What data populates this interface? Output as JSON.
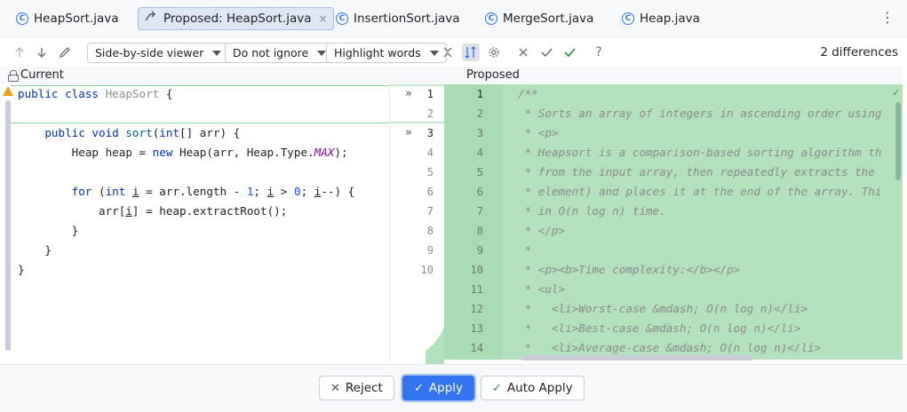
{
  "tabs": [
    {
      "label": "HeapSort.java",
      "icon": "class-icon",
      "active": false
    },
    {
      "label": "Proposed: HeapSort.java",
      "icon": "merge-icon",
      "active": true
    },
    {
      "label": "InsertionSort.java",
      "icon": "class-icon",
      "active": false
    },
    {
      "label": "MergeSort.java",
      "icon": "class-icon",
      "active": false
    },
    {
      "label": "Heap.java",
      "icon": "class-icon",
      "active": false
    }
  ],
  "class_icon_letter": "C",
  "tab_close": "×",
  "more_glyph": "⋮",
  "toolbar": {
    "viewer": "Side-by-side viewer",
    "ignore": "Do not ignore",
    "highlight": "Highlight words",
    "differences": "2 differences",
    "help": "?"
  },
  "panes": {
    "current": "Current",
    "proposed": "Proposed"
  },
  "left_code": [
    "public class HeapSort {",
    "",
    "    public void sort(int[] arr) {",
    "        Heap heap = new Heap(arr, Heap.Type.MAX);",
    "",
    "        for (int i = arr.length - 1; i > 0; i--) {",
    "            arr[i] = heap.extractRoot();",
    "        }",
    "    }",
    "}"
  ],
  "left_numbers": [
    "1",
    "2",
    "3",
    "4",
    "5",
    "6",
    "7",
    "8",
    "9",
    "10"
  ],
  "right_numbers": [
    "1",
    "2",
    "3",
    "4",
    "5",
    "6",
    "7",
    "8",
    "9",
    "10",
    "11",
    "12",
    "13",
    "14"
  ],
  "right_code": [
    "/**",
    " * Sorts an array of integers in ascending order using",
    " * <p>",
    " * Heapsort is a comparison-based sorting algorithm th",
    " * from the input array, then repeatedly extracts the",
    " * element) and places it at the end of the array. Thi",
    " * in O(n log n) time.",
    " * </p>",
    " *",
    " * <p><b>Time complexity:</b></p>",
    " * <ul>",
    " *   <li>Worst-case &mdash; O(n log n)</li>",
    " *   <li>Best-case &mdash; O(n log n)</li>",
    " *   <li>Average-case &mdash; O(n log n)</li>"
  ],
  "buttons": {
    "reject": "Reject",
    "apply": "Apply",
    "auto_apply": "Auto Apply"
  },
  "colors": {
    "accent": "#3574f0",
    "added_bg": "#b3e0bd",
    "success": "#369650"
  }
}
